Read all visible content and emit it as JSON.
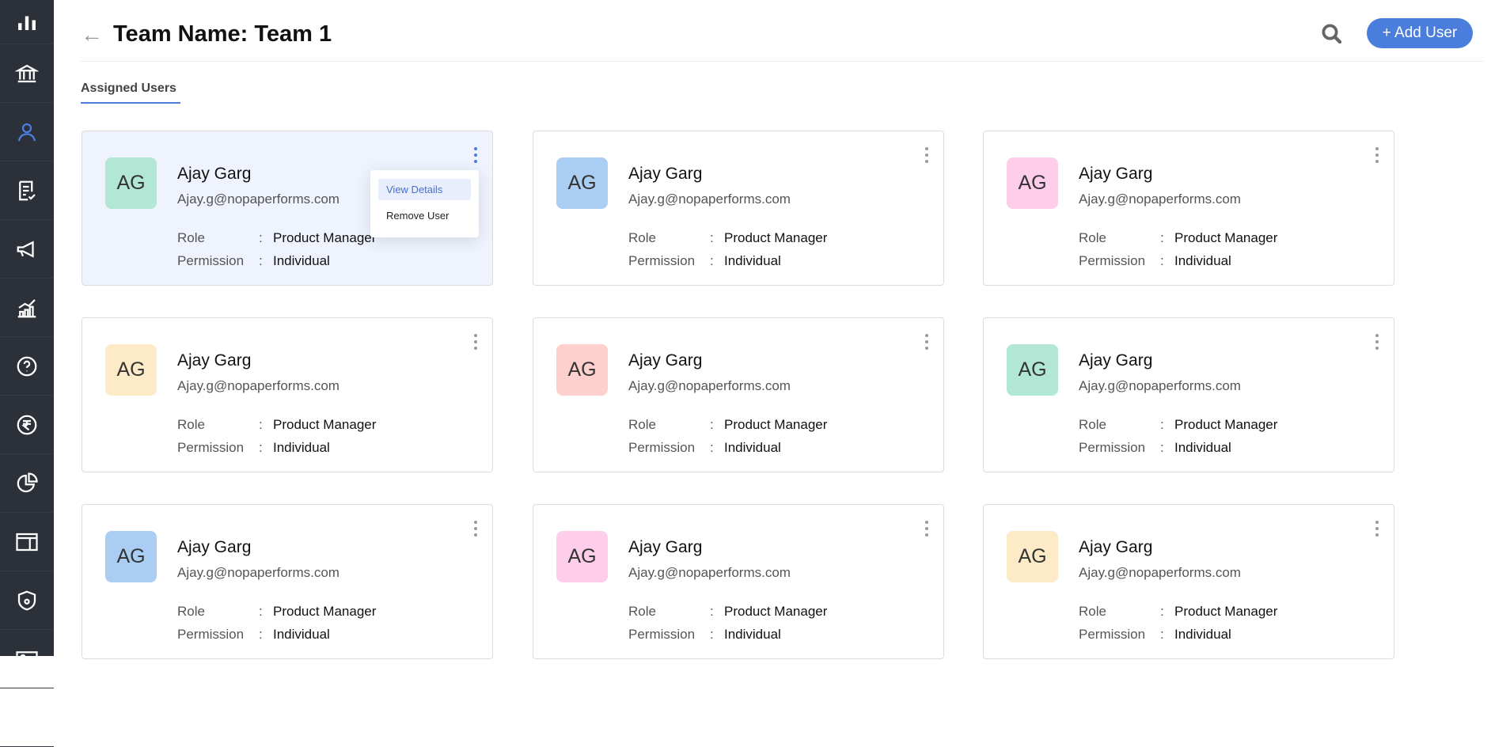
{
  "sidebar": {
    "items": [
      "analytics",
      "institution",
      "users",
      "forms",
      "campaigns",
      "reports",
      "help",
      "payments",
      "charts",
      "templates",
      "security",
      "id-card",
      "integrations"
    ],
    "active": "users"
  },
  "header": {
    "back": "←",
    "title": "Team Name: Team 1",
    "add_user": "+ Add User"
  },
  "tabs": [
    {
      "label": "Assigned Users",
      "active": true
    }
  ],
  "labels": {
    "role": "Role",
    "permission": "Permission",
    "colon": ":"
  },
  "menu": {
    "view": "View Details",
    "remove": "Remove User"
  },
  "users": [
    {
      "initials": "AG",
      "name": "Ajay Garg",
      "email": "Ajay.g@nopaperforms.com",
      "role": "Product Manager",
      "permission": "Individual",
      "color": "#b2e6d5"
    },
    {
      "initials": "AG",
      "name": "Ajay Garg",
      "email": "Ajay.g@nopaperforms.com",
      "role": "Product Manager",
      "permission": "Individual",
      "color": "#aacdf4"
    },
    {
      "initials": "AG",
      "name": "Ajay Garg",
      "email": "Ajay.g@nopaperforms.com",
      "role": "Product Manager",
      "permission": "Individual",
      "color": "#fdcdea"
    },
    {
      "initials": "AG",
      "name": "Ajay Garg",
      "email": "Ajay.g@nopaperforms.com",
      "role": "Product Manager",
      "permission": "Individual",
      "color": "#fdeac6"
    },
    {
      "initials": "AG",
      "name": "Ajay Garg",
      "email": "Ajay.g@nopaperforms.com",
      "role": "Product Manager",
      "permission": "Individual",
      "color": "#fdd0cd"
    },
    {
      "initials": "AG",
      "name": "Ajay Garg",
      "email": "Ajay.g@nopaperforms.com",
      "role": "Product Manager",
      "permission": "Individual",
      "color": "#b2e6d5"
    },
    {
      "initials": "AG",
      "name": "Ajay Garg",
      "email": "Ajay.g@nopaperforms.com",
      "role": "Product Manager",
      "permission": "Individual",
      "color": "#aacdf4"
    },
    {
      "initials": "AG",
      "name": "Ajay Garg",
      "email": "Ajay.g@nopaperforms.com",
      "role": "Product Manager",
      "permission": "Individual",
      "color": "#fdcdea"
    },
    {
      "initials": "AG",
      "name": "Ajay Garg",
      "email": "Ajay.g@nopaperforms.com",
      "role": "Product Manager",
      "permission": "Individual",
      "color": "#fdeac6"
    }
  ]
}
